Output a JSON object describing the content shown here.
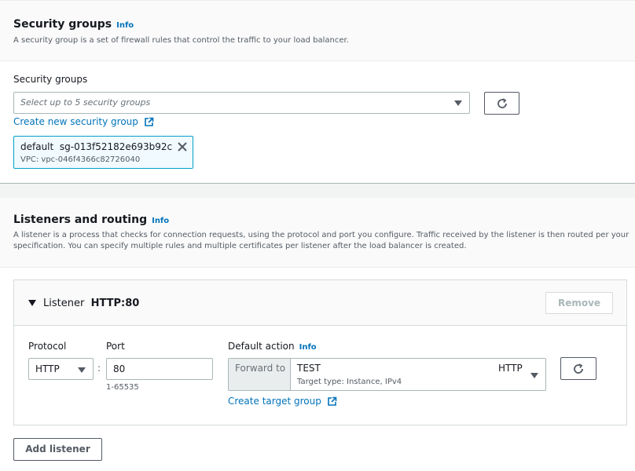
{
  "security_section": {
    "title": "Security groups",
    "info": "Info",
    "description": "A security group is a set of firewall rules that control the traffic to your load balancer.",
    "field_label": "Security groups",
    "placeholder": "Select up to 5 security groups",
    "create_link": "Create new security group",
    "selected": {
      "name": "default",
      "id": "sg-013f52182e693b92c",
      "vpc": "VPC: vpc-046f4366c82726040"
    }
  },
  "listeners_section": {
    "title": "Listeners and routing",
    "info": "Info",
    "description_line1": "A listener is a process that checks for connection requests, using the protocol and port you configure. Traffic received by the listener is then routed per your",
    "description_line2": "specification. You can specify multiple rules and multiple certificates per listener after the load balancer is created.",
    "listener": {
      "label": "Listener",
      "value": "HTTP:80",
      "remove_label": "Remove",
      "protocol_label": "Protocol",
      "protocol_value": "HTTP",
      "separator": ":",
      "port_label": "Port",
      "port_value": "80",
      "port_hint": "1-65535",
      "default_action_label": "Default action",
      "default_action_info": "Info",
      "forward_to": "Forward to",
      "target_name": "TEST",
      "target_protocol": "HTTP",
      "target_detail": "Target type: Instance, IPv4",
      "create_target_link": "Create target group"
    },
    "add_listener_label": "Add listener"
  }
}
